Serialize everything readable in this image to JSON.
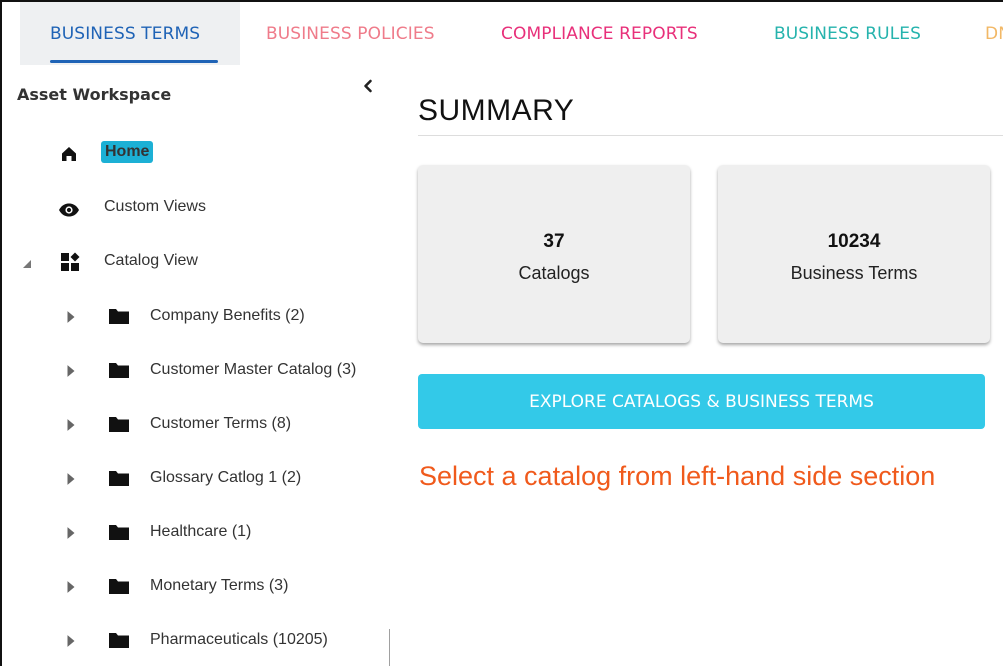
{
  "tabs": [
    {
      "label": "BUSINESS TERMS",
      "color": "#1f63b6",
      "active": true
    },
    {
      "label": "BUSINESS POLICIES",
      "color": "#ef7b8a",
      "active": false
    },
    {
      "label": "COMPLIANCE REPORTS",
      "color": "#e8307a",
      "active": false
    },
    {
      "label": "BUSINESS RULES",
      "color": "#26b3ad",
      "active": false
    },
    {
      "label": "DN",
      "color": "#f2b866",
      "active": false
    }
  ],
  "sidebar": {
    "title": "Asset Workspace",
    "home_label": "Home",
    "custom_views_label": "Custom Views",
    "catalog_view_label": "Catalog View",
    "catalogs": [
      {
        "label": "Company Benefits (2)"
      },
      {
        "label": "Customer Master Catalog (3)"
      },
      {
        "label": "Customer Terms (8)"
      },
      {
        "label": "Glossary Catlog 1 (2)"
      },
      {
        "label": "Healthcare (1)"
      },
      {
        "label": "Monetary Terms (3)"
      },
      {
        "label": "Pharmaceuticals (10205)"
      }
    ]
  },
  "main": {
    "title": "SUMMARY",
    "cards": [
      {
        "value": "37",
        "caption": "Catalogs"
      },
      {
        "value": "10234",
        "caption": "Business Terms"
      }
    ],
    "explore_label": "EXPLORE CATALOGS & BUSINESS TERMS",
    "hint": "Select a catalog from left-hand side section"
  },
  "colors": {
    "home_badge": "#1cb0d5",
    "explore_button": "#33c9e8",
    "hint_text": "#f05a1c",
    "active_tab_underline": "#1f63b6"
  },
  "icons": {
    "home": "home-icon",
    "custom_views": "eye-icon",
    "catalog_view": "dashboard-icon",
    "folder": "folder-icon",
    "collapse": "chevron-left-icon"
  }
}
